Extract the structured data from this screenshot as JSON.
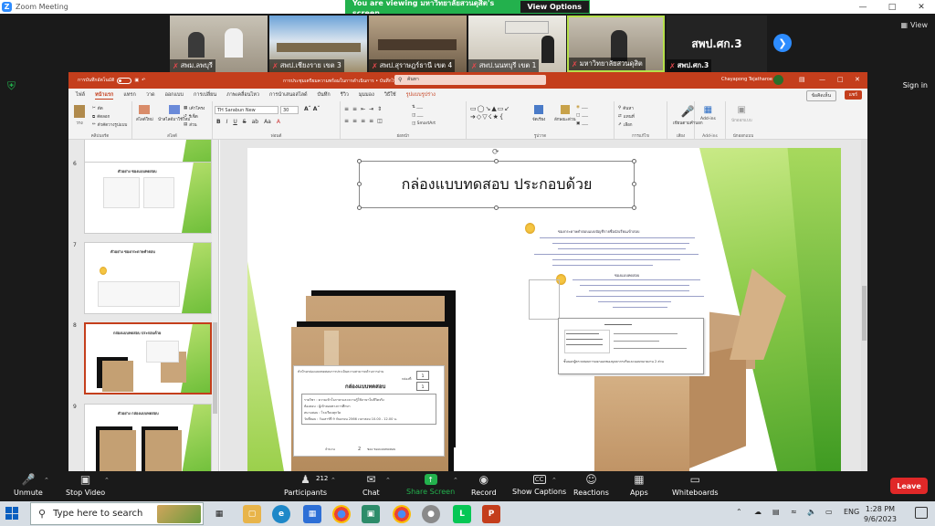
{
  "zoom": {
    "window_title": "Zoom Meeting",
    "banner_text": "You are viewing มหาวิทยาลัยสวนดุสิต's screen",
    "view_options_label": "View Options",
    "view_label": "View",
    "sign_in_label": "Sign in",
    "participants": [
      {
        "name": "สพม.ลพบุรี"
      },
      {
        "name": "สพป.เชียงราย เขต 3"
      },
      {
        "name": "สพป.สุราษฎร์ธานี เขต 4"
      },
      {
        "name": "สพป.นนทบุรี เขต 1"
      },
      {
        "name": "มหาวิทยาลัยสวนดุสิต"
      },
      {
        "name": "สพป.ศก.3",
        "tile_text": "สพป.ศก.3"
      }
    ],
    "toolbar": {
      "unmute_label": "Unmute",
      "stop_video_label": "Stop Video",
      "participants_label": "Participants",
      "participants_count": "212",
      "chat_label": "Chat",
      "share_screen_label": "Share Screen",
      "record_label": "Record",
      "captions_label": "Show Captions",
      "reactions_label": "Reactions",
      "apps_label": "Apps",
      "whiteboards_label": "Whiteboards",
      "leave_label": "Leave"
    }
  },
  "powerpoint": {
    "autosave_label": "การบันทึกอัตโนมัติ",
    "doc_title": "การประชุมเตรียมความพร้อมในการดำเนินการ • บันทึกไปยัง พีซีนี้",
    "search_placeholder": "ค้นหา",
    "user_name": "Chayapong Tejatharoe",
    "tabs": [
      "ไฟล์",
      "หน้าแรก",
      "แทรก",
      "วาด",
      "ออกแบบ",
      "การเปลี่ยน",
      "ภาพเคลื่อนไหว",
      "การนำเสนอสไลด์",
      "บันทึก",
      "รีวิว",
      "มุมมอง",
      "วิธีใช้",
      "รูปแบบรูปร่าง"
    ],
    "active_tab": "หน้าแรก",
    "comments_label": "ข้อคิดเห็น",
    "share_label": "แชร์",
    "ribbon": {
      "font_name": "TH Sarabun New",
      "font_size": "30",
      "groups": [
        "คลิปบอร์ด",
        "สไลด์",
        "ฟอนต์",
        "ย่อหน้า",
        "รูปวาด",
        "การแก้ไข",
        "เสียง",
        "Add-ins",
        "นักออกแบบ"
      ],
      "paste_label": "วาง",
      "new_slide_label": "สไลด์ใหม่",
      "reuse_label": "นำสไลด์มาใช้ใหม่",
      "layout_label": "เค้าโครง",
      "reset_label": "รีเซ็ต",
      "section_label": "ส่วน",
      "cut_label": "ตัด",
      "copy_label": "คัดลอก",
      "format_painter_label": "ตัวคัดวางรูปแบบ",
      "arrange_label": "จัดเรียง",
      "quick_styles_label": "ลักษณะด่วน",
      "find_label": "ค้นหา",
      "replace_label": "แทนที่",
      "select_label": "เลือก",
      "dictate_label": "เขียนตามคำบอก",
      "addins_label": "Add-ins",
      "designer_label": "นักออกแบบ"
    },
    "thumbnails": [
      {
        "num": "6",
        "title": "ตัวอย่าง ซองแบบทดสอบ"
      },
      {
        "num": "7",
        "title": "ตัวอย่าง ซองกระดาษคำตอบ"
      },
      {
        "num": "8",
        "title": "กล่องแบบทดสอบ ประกอบด้วย"
      },
      {
        "num": "9",
        "title": "ตัวอย่าง กล่องแบบทดสอบ"
      }
    ],
    "slide": {
      "title": "กล่องแบบทดสอบ ประกอบด้วย",
      "label_sheet": {
        "header": "หัวป้ายกล่องแบบทดสอบการประเมินความสามารถด้านการอ่าน",
        "title": "กล่องแบบทดสอบ",
        "box_no_label": "กล่องที่",
        "box_no": "1",
        "box_total": "1",
        "line1": "รายวิชา : ความเข้าใจภาษาและความรู้ใช้ภาษาในชีวิตจริง",
        "line2": "ห้องสอบ : ผู้เข้าสอบทางการศึกษา",
        "line3": "สนามสอบ : โรงเรียนทุกวัด",
        "line4": "วันที่สอบ : วันเสาร์ที่ 9 กันยายน 2566 เวลาสอบ 10.00 - 12.00 น.",
        "count_label": "จำนวน",
        "count_value": "2",
        "count_unit": "ซอง ซองแบบทดสอบ"
      },
      "doc": {
        "line1": "ซองกระดาษคำตอบแบบบัญชีรายชื่อนักเรียนเข้าสอบ",
        "line2": "ซองแบบทดสอบ",
        "form_footnote": "ชั้นนอกผู้ตรวจสอบการแยกออกของบุคลากรจริงและมอบหมายงาน 2 ส่วน"
      }
    }
  },
  "taskbar": {
    "search_placeholder": "Type here to search",
    "language": "ENG",
    "time": "1:28 PM",
    "date": "9/6/2023"
  }
}
